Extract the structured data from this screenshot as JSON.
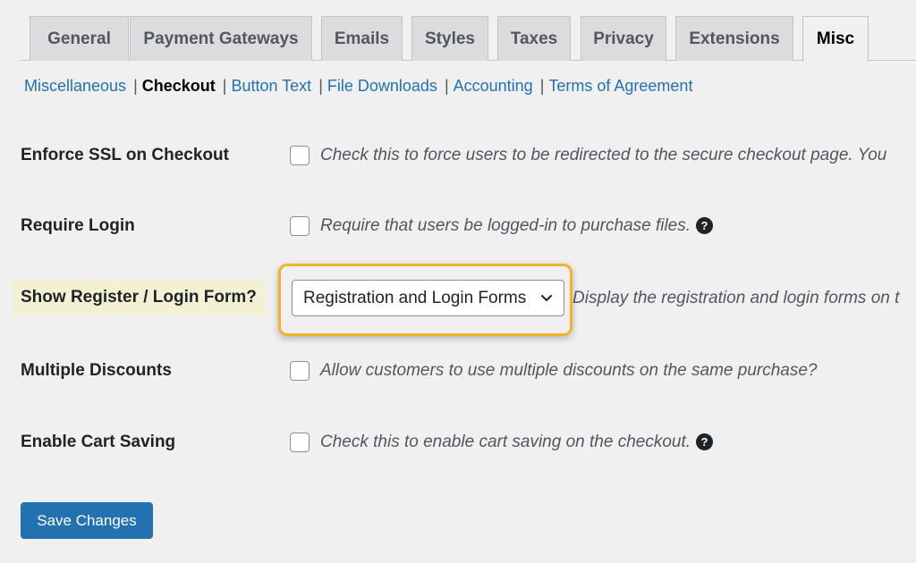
{
  "tabs": [
    {
      "label": "General"
    },
    {
      "label": "Payment Gateways"
    },
    {
      "label": "Emails"
    },
    {
      "label": "Styles"
    },
    {
      "label": "Taxes"
    },
    {
      "label": "Privacy"
    },
    {
      "label": "Extensions"
    },
    {
      "label": "Misc",
      "active": true
    }
  ],
  "subnav": {
    "items": [
      {
        "label": "Miscellaneous"
      },
      {
        "label": "Checkout",
        "current": true
      },
      {
        "label": "Button Text"
      },
      {
        "label": "File Downloads"
      },
      {
        "label": "Accounting"
      },
      {
        "label": "Terms of Agreement"
      }
    ],
    "separator": "|"
  },
  "settings": {
    "enforce_ssl": {
      "label": "Enforce SSL on Checkout",
      "description": "Check this to force users to be redirected to the secure checkout page. You",
      "checked": false
    },
    "require_login": {
      "label": "Require Login",
      "description": "Require that users be logged-in to purchase files.",
      "checked": false,
      "help": "?"
    },
    "show_register_login": {
      "label": "Show Register / Login Form?",
      "selected": "Registration and Login Forms",
      "description": "Display the registration and login forms on t"
    },
    "multiple_discounts": {
      "label": "Multiple Discounts",
      "description": "Allow customers to use multiple discounts on the same purchase?",
      "checked": false
    },
    "cart_saving": {
      "label": "Enable Cart Saving",
      "description": "Check this to enable cart saving on the checkout.",
      "checked": false,
      "help": "?"
    }
  },
  "save_button": {
    "label": "Save Changes"
  },
  "colors": {
    "accent": "#2271b1",
    "highlight_border": "#f0b429",
    "label_highlight_bg": "#f3f1d4",
    "background": "#f0f0f1"
  }
}
